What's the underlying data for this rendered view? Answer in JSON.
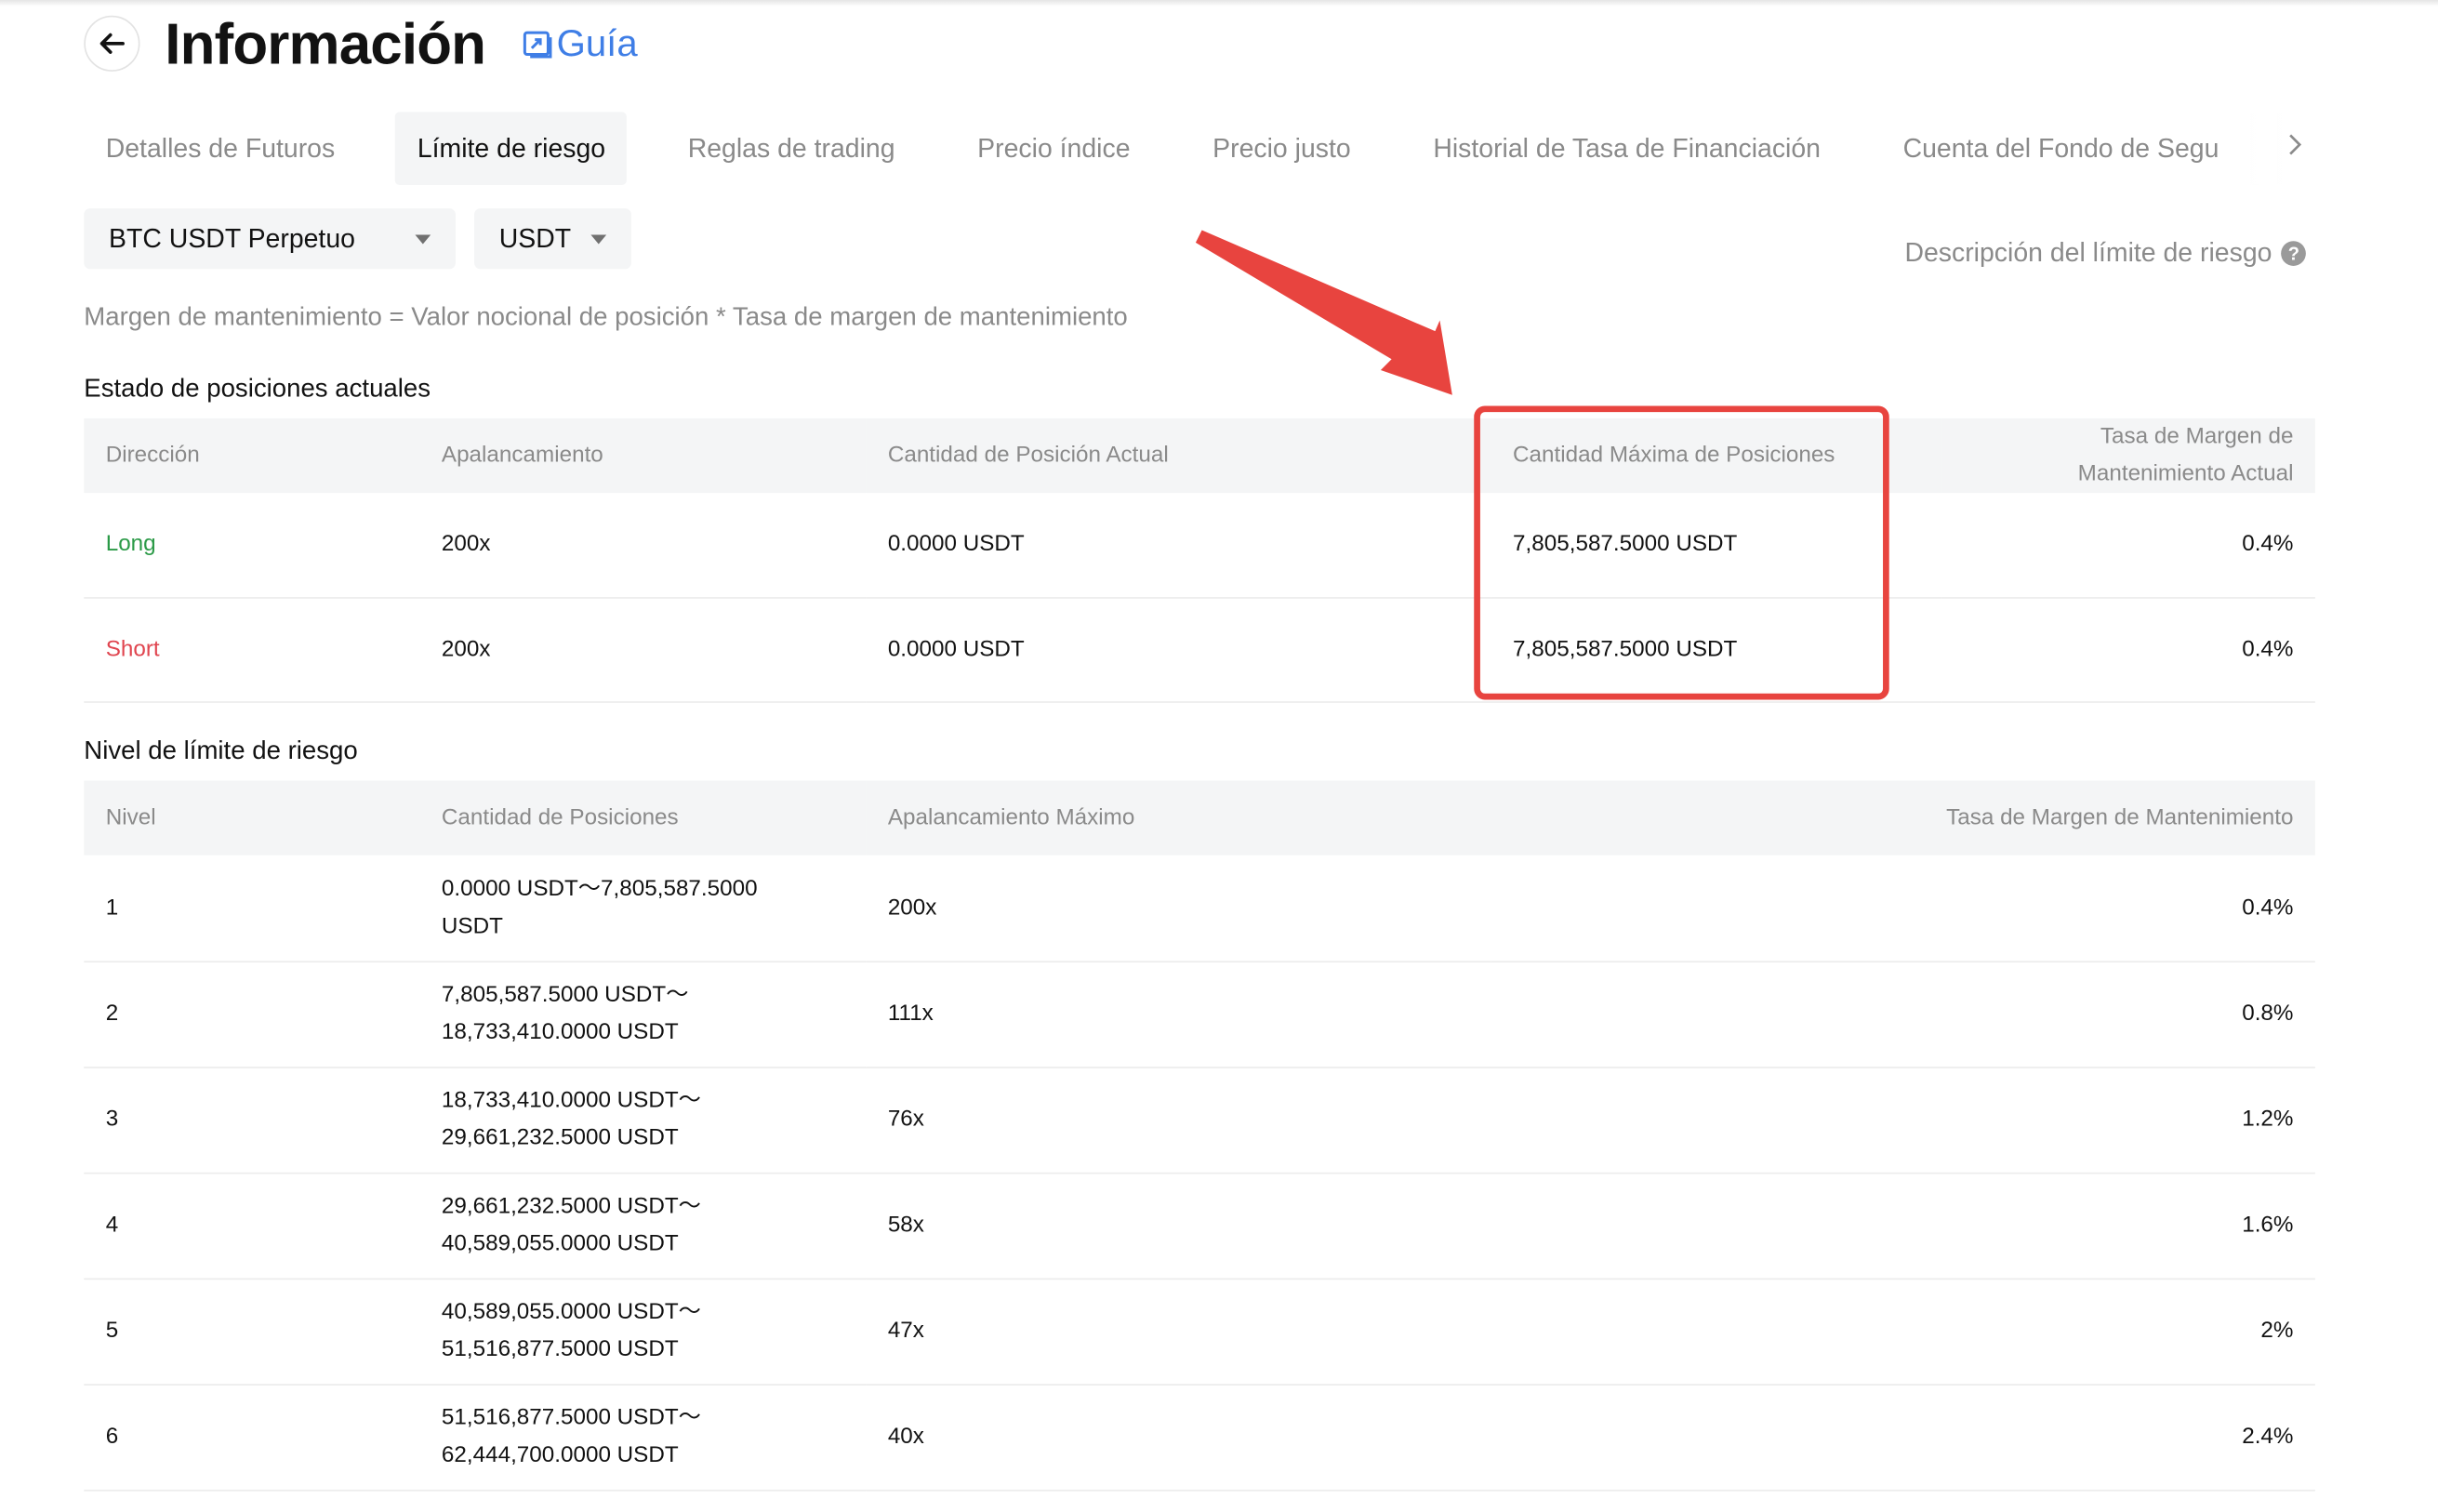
{
  "header": {
    "title": "Información",
    "guide_label": "Guía"
  },
  "tabs": [
    {
      "label": "Detalles de Futuros",
      "active": false
    },
    {
      "label": "Límite de riesgo",
      "active": true
    },
    {
      "label": "Reglas de trading",
      "active": false
    },
    {
      "label": "Precio índice",
      "active": false
    },
    {
      "label": "Precio justo",
      "active": false
    },
    {
      "label": "Historial de Tasa de Financiación",
      "active": false
    },
    {
      "label": "Cuenta del Fondo de Segu",
      "active": false
    }
  ],
  "filters": {
    "contract": "BTC USDT Perpetuo",
    "currency": "USDT"
  },
  "risk_description_link": "Descripción del límite de riesgo",
  "formula": "Margen de mantenimiento = Valor nocional de posición * Tasa de margen de mantenimiento",
  "current_positions": {
    "title": "Estado de posiciones actuales",
    "headers": [
      "Dirección",
      "Apalancamiento",
      "Cantidad de Posición Actual",
      "Cantidad Máxima de Posiciones",
      "Tasa de Margen de",
      "Mantenimiento Actual"
    ],
    "rows": [
      {
        "direction": "Long",
        "leverage": "200x",
        "current": "0.0000 USDT",
        "max": "7,805,587.5000 USDT",
        "rate": "0.4%"
      },
      {
        "direction": "Short",
        "leverage": "200x",
        "current": "0.0000 USDT",
        "max": "7,805,587.5000 USDT",
        "rate": "0.4%"
      }
    ]
  },
  "risk_levels": {
    "title": "Nivel de límite de riesgo",
    "headers": [
      "Nivel",
      "Cantidad de Posiciones",
      "Apalancamiento Máximo",
      "Tasa de Margen de Mantenimiento"
    ],
    "rows": [
      {
        "level": "1",
        "range_a": "0.0000 USDT～7,805,587.5000",
        "range_b": "USDT",
        "leverage": "200x",
        "rate": "0.4%"
      },
      {
        "level": "2",
        "range_a": "7,805,587.5000 USDT～",
        "range_b": "18,733,410.0000 USDT",
        "leverage": "111x",
        "rate": "0.8%"
      },
      {
        "level": "3",
        "range_a": "18,733,410.0000 USDT～",
        "range_b": "29,661,232.5000 USDT",
        "leverage": "76x",
        "rate": "1.2%"
      },
      {
        "level": "4",
        "range_a": "29,661,232.5000 USDT～",
        "range_b": "40,589,055.0000 USDT",
        "leverage": "58x",
        "rate": "1.6%"
      },
      {
        "level": "5",
        "range_a": "40,589,055.0000 USDT～",
        "range_b": "51,516,877.5000 USDT",
        "leverage": "47x",
        "rate": "2%"
      },
      {
        "level": "6",
        "range_a": "51,516,877.5000 USDT～",
        "range_b": "62,444,700.0000 USDT",
        "leverage": "40x",
        "rate": "2.4%"
      }
    ]
  },
  "annotation_colors": {
    "highlight": "#e8443f",
    "long": "#2b9a47",
    "short": "#e0454f",
    "link": "#3f7ee6"
  }
}
